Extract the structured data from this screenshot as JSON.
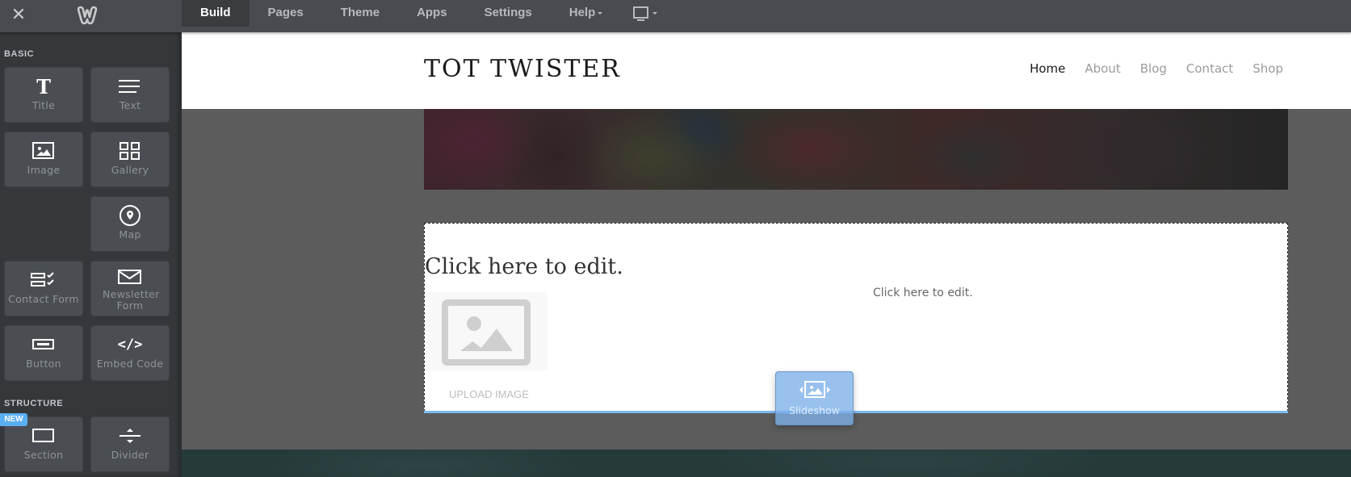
{
  "topbar": {
    "close_icon": "close-icon",
    "logo_icon": "weebly-logo-icon",
    "tabs": [
      {
        "label": "Build",
        "active": true
      },
      {
        "label": "Pages",
        "active": false
      },
      {
        "label": "Theme",
        "active": false
      },
      {
        "label": "Apps",
        "active": false
      },
      {
        "label": "Settings",
        "active": false
      },
      {
        "label": "Help",
        "active": false,
        "dropdown": true
      }
    ],
    "device_icon": "desktop-monitor-icon"
  },
  "sidebar": {
    "sections": [
      {
        "title": "BASIC",
        "items": [
          {
            "label": "Title",
            "icon": "title-T-icon"
          },
          {
            "label": "Text",
            "icon": "text-lines-icon"
          },
          {
            "label": "Image",
            "icon": "image-icon"
          },
          {
            "label": "Gallery",
            "icon": "gallery-grid-icon"
          },
          {
            "label": "Map",
            "icon": "map-pin-icon"
          },
          {
            "label": "Contact Form",
            "icon": "contact-form-icon"
          },
          {
            "label": "Newsletter Form",
            "icon": "envelope-icon"
          },
          {
            "label": "Button",
            "icon": "button-icon"
          },
          {
            "label": "Embed Code",
            "icon": "code-icon"
          }
        ]
      },
      {
        "title": "STRUCTURE",
        "badge": "NEW",
        "items": [
          {
            "label": "Section",
            "icon": "section-icon"
          },
          {
            "label": "Divider",
            "icon": "divider-icon"
          }
        ]
      }
    ]
  },
  "site": {
    "title": "TOT TWISTER",
    "nav": [
      {
        "label": "Home",
        "active": true
      },
      {
        "label": "About",
        "active": false
      },
      {
        "label": "Blog",
        "active": false
      },
      {
        "label": "Contact",
        "active": false
      },
      {
        "label": "Shop",
        "active": false
      }
    ],
    "edit_block": {
      "heading": "Click here to edit.",
      "paragraph": "Click here to edit.",
      "upload_label": "UPLOAD IMAGE"
    }
  },
  "drag_ghost": {
    "label": "Slideshow",
    "icon": "slideshow-icon"
  },
  "colors": {
    "accent": "#5aaef2",
    "drop_indicator": "#7cb8f0",
    "topbar": "#484c50",
    "sidebar": "#34383b"
  }
}
